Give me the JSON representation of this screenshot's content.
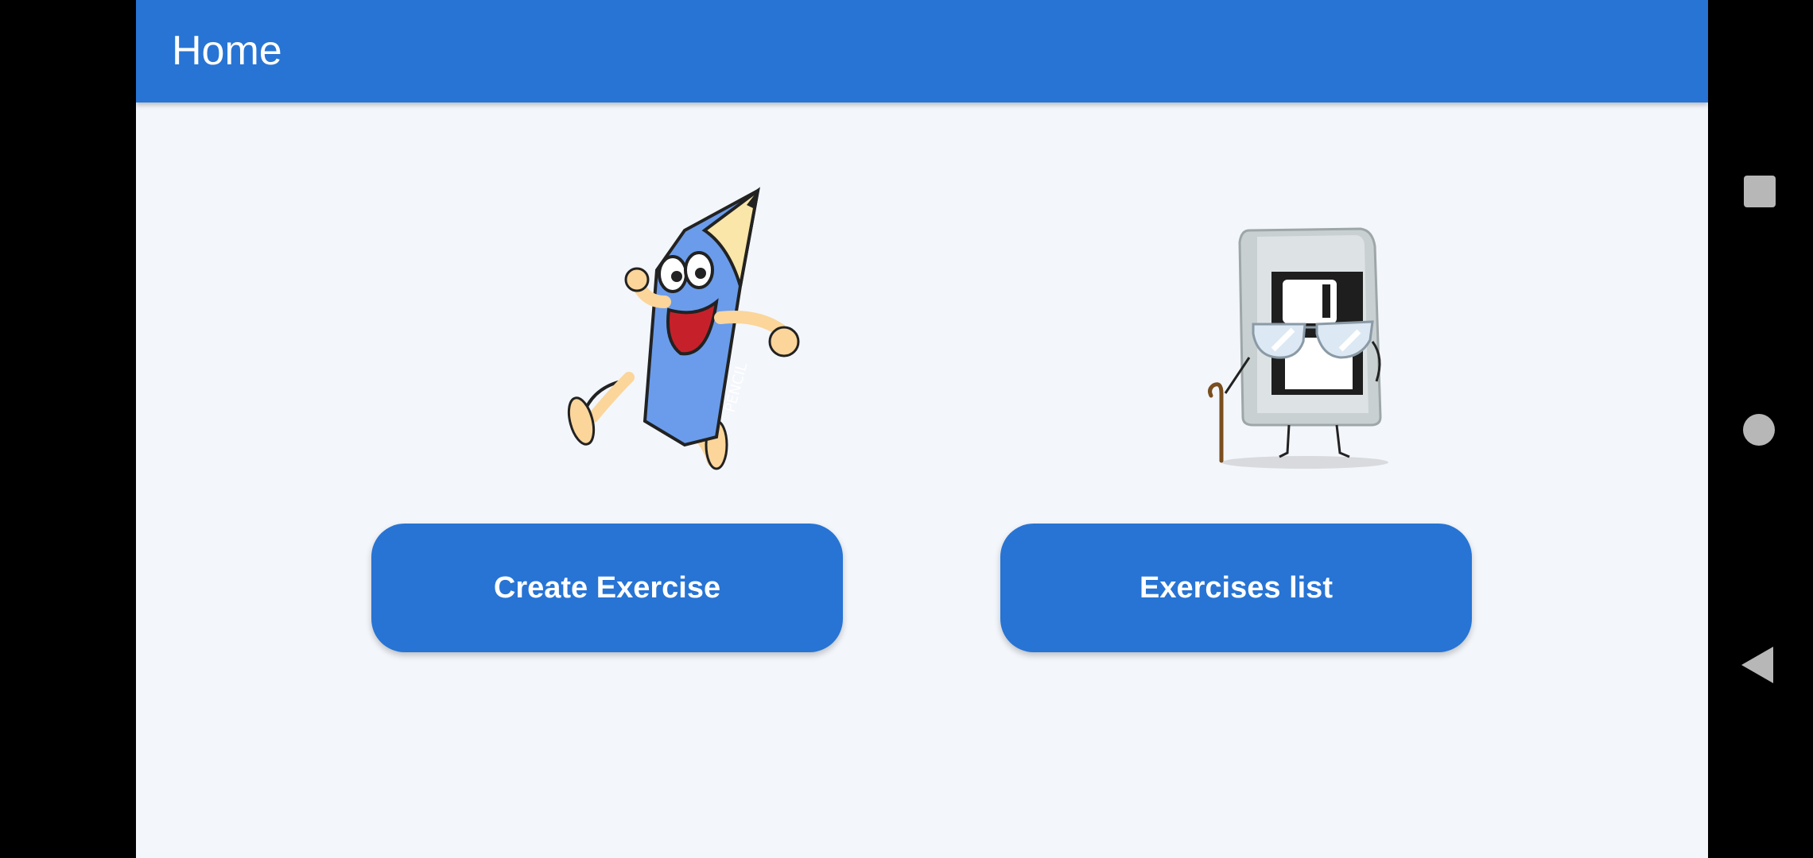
{
  "appbar": {
    "title": "Home"
  },
  "cards": [
    {
      "illustration": "running-pencil-cartoon",
      "button_label": "Create Exercise"
    },
    {
      "illustration": "floppy-disk-with-glasses-cartoon",
      "button_label": "Exercises list"
    }
  ],
  "system_nav": {
    "icons": [
      "recents-square-icon",
      "home-circle-icon",
      "back-triangle-icon"
    ]
  },
  "colors": {
    "primary": "#2774D4",
    "background": "#F3F6FB",
    "nav_bar": "#000000"
  }
}
